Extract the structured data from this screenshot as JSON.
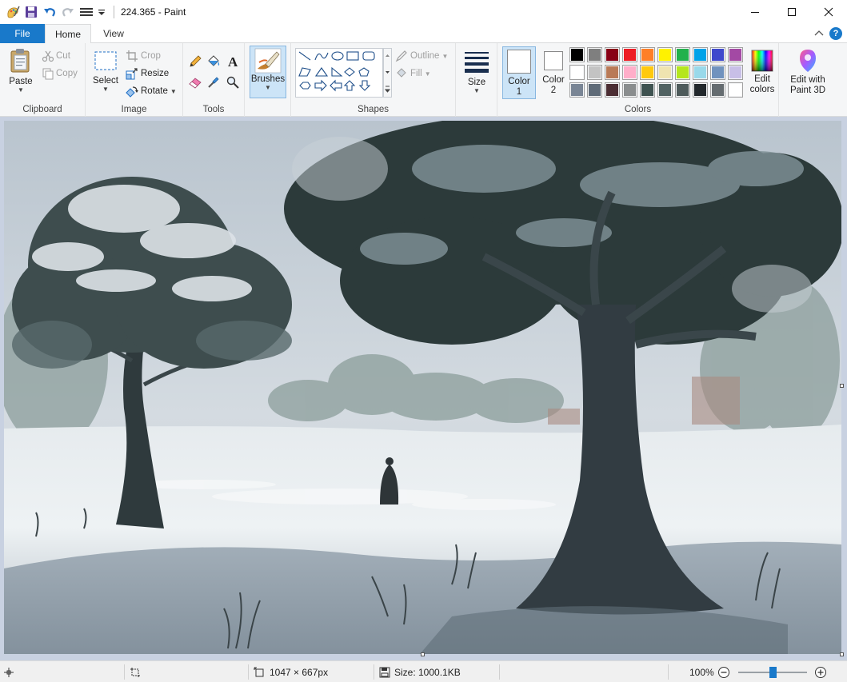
{
  "window": {
    "title": "224.365 - Paint",
    "controls": [
      "minimize",
      "maximize",
      "close"
    ]
  },
  "tabs": [
    {
      "label": "File"
    },
    {
      "label": "Home"
    },
    {
      "label": "View"
    }
  ],
  "ribbon": {
    "clipboard": {
      "label": "Clipboard",
      "paste": "Paste",
      "cut": "Cut",
      "copy": "Copy"
    },
    "image": {
      "label": "Image",
      "select": "Select",
      "crop": "Crop",
      "resize": "Resize",
      "rotate": "Rotate"
    },
    "tools": {
      "label": "Tools"
    },
    "brushes": {
      "label": "Brushes"
    },
    "shapes": {
      "label": "Shapes",
      "outline": "Outline",
      "fill": "Fill"
    },
    "size": {
      "label": "Size"
    },
    "colors": {
      "label": "Colors",
      "color1": "Color 1",
      "color2": "Color 2",
      "color1_value": "#ffffff",
      "color2_value": "#ffffff",
      "edit_colors": "Edit colors",
      "edit_paint3d": "Edit with Paint 3D",
      "palette": [
        [
          "#000000",
          "#7f7f7f",
          "#880015",
          "#ed1c24",
          "#ff7f27",
          "#fff200",
          "#22b14c",
          "#00a2e8",
          "#3f48cc",
          "#a349a4"
        ],
        [
          "#ffffff",
          "#c3c3c3",
          "#b97a57",
          "#ffaec9",
          "#ffc90e",
          "#efe4b0",
          "#b5e61d",
          "#99d9ea",
          "#7092be",
          "#c8bfe7"
        ],
        [
          "#798595",
          "#5f6b78",
          "#4b2d33",
          "#8a8d8e",
          "#3e5250",
          "#516262",
          "#4e5b5b",
          "#22282c",
          "#656c70",
          "#ffffff"
        ]
      ]
    }
  },
  "status": {
    "image_size": "1047 × 667px",
    "file_size": "Size: 1000.1KB",
    "zoom": "100%",
    "zoom_level": 0.5
  }
}
